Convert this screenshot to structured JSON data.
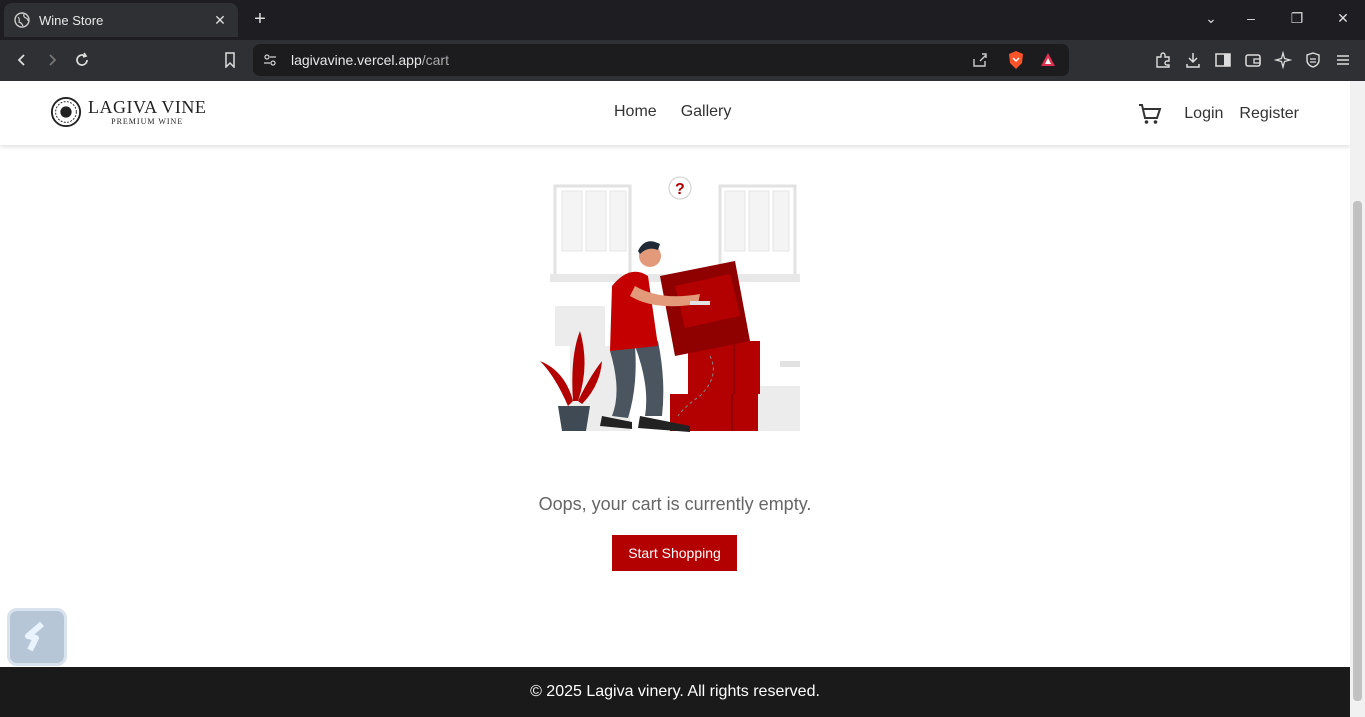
{
  "browser": {
    "tab_title": "Wine Store",
    "url_host": "lagivavine.vercel.app",
    "url_path": "/cart"
  },
  "site": {
    "logo_name": "LAGIVA VINE",
    "logo_sub": "PREMIUM WINE",
    "nav": [
      {
        "label": "Home"
      },
      {
        "label": "Gallery"
      }
    ],
    "login_label": "Login",
    "register_label": "Register"
  },
  "cart": {
    "empty_message": "Oops, your cart is currently empty.",
    "start_shopping_label": "Start Shopping"
  },
  "footer": {
    "text": "© 2025 Lagiva vinery. All rights reserved."
  },
  "colors": {
    "accent": "#b30000",
    "footer_bg": "#1a1a1a"
  }
}
